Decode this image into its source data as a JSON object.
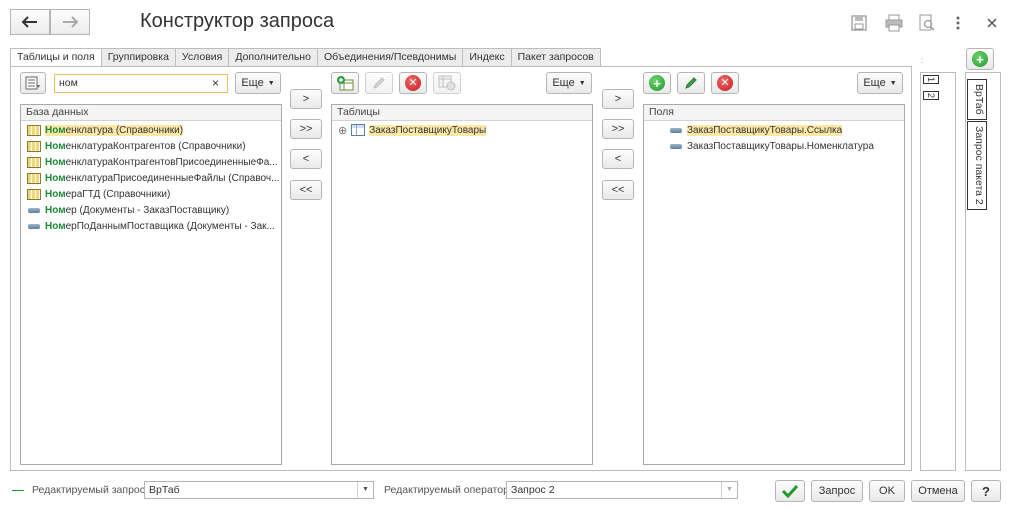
{
  "window": {
    "title": "Конструктор запроса",
    "icons": [
      "back-arrow-icon",
      "forward-arrow-icon",
      "save-icon",
      "print-icon",
      "preview-icon",
      "more-icon",
      "close-icon"
    ]
  },
  "tabs": [
    {
      "label": "Таблицы и поля",
      "active": true
    },
    {
      "label": "Группировка",
      "active": false
    },
    {
      "label": "Условия",
      "active": false
    },
    {
      "label": "Дополнительно",
      "active": false
    },
    {
      "label": "Объединения/Псевдонимы",
      "active": false
    },
    {
      "label": "Индекс",
      "active": false
    },
    {
      "label": "Пакет запросов",
      "active": false
    }
  ],
  "database": {
    "search_value": "ном",
    "clear_label": "×",
    "more_label": "Еще",
    "header": "База данных",
    "items": [
      {
        "match": "Ном",
        "rest": "енклатура (Справочники)",
        "icon": "table-icon",
        "selected": true
      },
      {
        "match": "Ном",
        "rest": "енклатураКонтрагентов (Справочники)",
        "icon": "table-icon",
        "selected": false
      },
      {
        "match": "Ном",
        "rest": "енклатураКонтрагентовПрисоединенныеФа...",
        "icon": "table-icon",
        "selected": false
      },
      {
        "match": "Ном",
        "rest": "енклатураПрисоединенныеФайлы (Справоч...",
        "icon": "table-icon",
        "selected": false
      },
      {
        "match": "Ном",
        "rest": "ераГТД (Справочники)",
        "icon": "table-icon",
        "selected": false
      },
      {
        "match": "Ном",
        "rest": "ер (Документы - ЗаказПоставщику)",
        "icon": "document-field-icon",
        "selected": false
      },
      {
        "match": "Ном",
        "rest": "ерПоДаннымПоставщика (Документы - Зак...",
        "icon": "document-field-icon",
        "selected": false
      }
    ]
  },
  "move_buttons": {
    "add": ">",
    "add_all": ">>",
    "remove": "<",
    "remove_all": "<<"
  },
  "tables": {
    "more_label": "Еще",
    "header": "Таблицы",
    "items": [
      {
        "label": "ЗаказПоставщикуТовары",
        "expand": "⊕",
        "selected": true
      }
    ]
  },
  "fields": {
    "more_label": "Еще",
    "header": "Поля",
    "items": [
      {
        "label": "ЗаказПоставщикуТовары.Ссылка",
        "selected": true
      },
      {
        "label": "ЗаказПоставщикуТовары.Номенклатура",
        "selected": false
      }
    ]
  },
  "query_tabs": {
    "numbers": [
      "1",
      "2"
    ],
    "batch": [
      "ВрТаб",
      "Запрос пакета 2"
    ],
    "add_label": "+"
  },
  "footer": {
    "edited_query_label": "Редактируемый запрос:",
    "edited_query_value": "ВрТаб",
    "edited_operator_label": "Редактируемый оператор:",
    "edited_operator_value": "Запрос 2",
    "query_button": "Запрос",
    "ok_button": "OK",
    "cancel_button": "Отмена",
    "help_button": "?"
  },
  "colors": {
    "match_highlight": "#1d8a3a",
    "selection": "#fbe8a6",
    "add_green": "#1f9a2c",
    "delete_red": "#c41b1b"
  }
}
